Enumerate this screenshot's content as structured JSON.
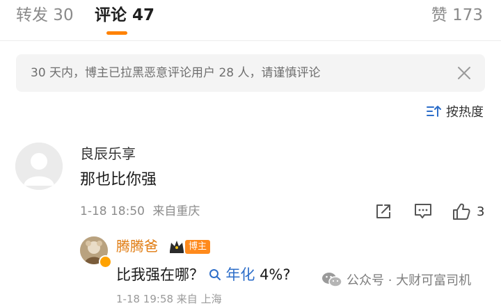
{
  "tabs": {
    "repost": "转发 30",
    "comments": "评论 47",
    "likes": "赞 173"
  },
  "notice": {
    "text": "30 天内，博主已拉黑恶意评论用户 28 人，请谨慎评论"
  },
  "sort": {
    "label": "按热度"
  },
  "comment": {
    "username": "良辰乐享",
    "text": "那也比你强",
    "date": "1-18 18:50",
    "location": "来自重庆",
    "like_count": "3"
  },
  "reply": {
    "username": "腾腾爸",
    "badge": "博主",
    "text_before": "比我强在哪？",
    "search_term": "年化",
    "text_after": " 4%?",
    "meta_partial": "1-18 19:58 来自 上海"
  },
  "watermark": {
    "text": "公众号 · 大财可富司机"
  },
  "colors": {
    "accent": "#ff8200",
    "blogger_name": "#e07b10",
    "link": "#2d6ec9"
  }
}
